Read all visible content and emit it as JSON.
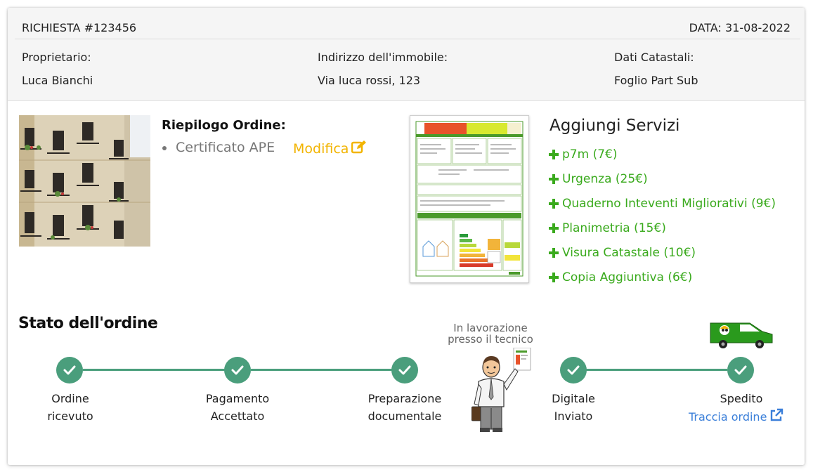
{
  "header": {
    "request": "RICHIESTA #123456",
    "date": "DATA: 31-08-2022",
    "owner_label": "Proprietario:",
    "owner_value": "Luca Bianchi",
    "address_label": "Indirizzo dell'immobile:",
    "address_value": "Via luca rossi, 123",
    "cadastral_label": "Dati Catastali:",
    "cadastral_value": "Foglio Part Sub"
  },
  "summary": {
    "title": "Riepilogo Ordine:",
    "item": "Certificato APE",
    "edit_label": "Modifica"
  },
  "services": {
    "title": "Aggiungi Servizi",
    "items": [
      "p7m (7€)",
      "Urgenza (25€)",
      "Quaderno Inteventi Migliorativi (9€)",
      "Planimetria (15€)",
      "Visura Catastale (10€)",
      "Copia Aggiuntiva (6€)"
    ]
  },
  "status": {
    "title": "Stato dell'ordine",
    "in_progress_line1": "In lavorazione",
    "in_progress_line2": "presso il tecnico",
    "steps": [
      {
        "line1": "Ordine",
        "line2": "ricevuto"
      },
      {
        "line1": "Pagamento",
        "line2": "Accettato"
      },
      {
        "line1": "Preparazione",
        "line2": "documentale"
      },
      {
        "line1": "Digitale",
        "line2": "Inviato"
      },
      {
        "line1": "Spedito",
        "line2": ""
      }
    ],
    "track_label": "Traccia ordine"
  },
  "colors": {
    "accent_green": "#3aaa1d",
    "step_green": "#4a9e7c",
    "edit_yellow": "#f2b400",
    "link_blue": "#3b7fd9"
  }
}
